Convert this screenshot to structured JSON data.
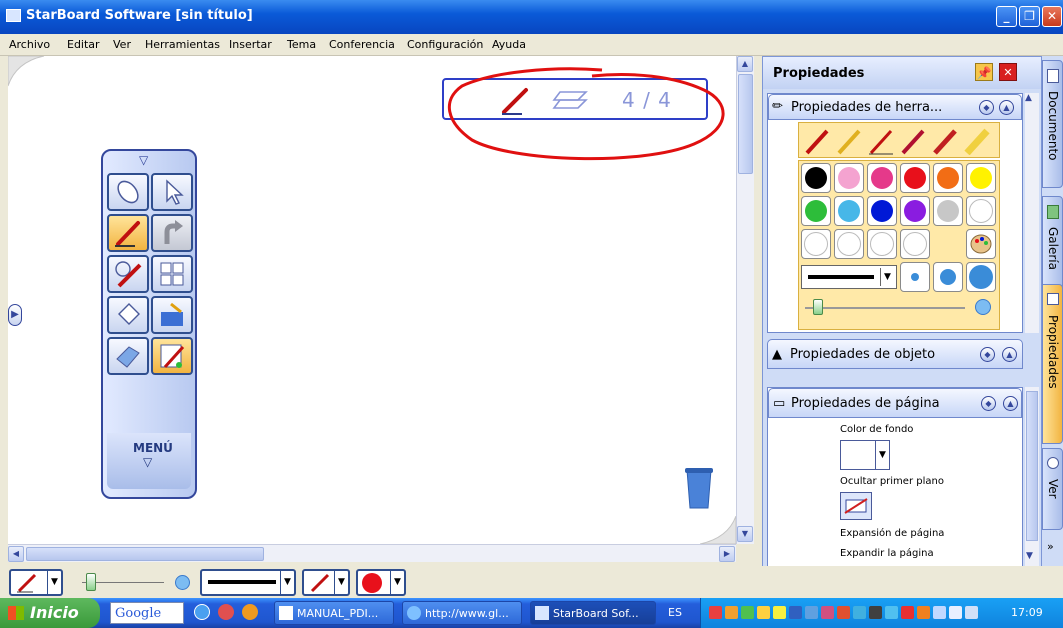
{
  "window": {
    "title": "StarBoard Software [sin título]"
  },
  "menu": [
    "Archivo",
    "Editar",
    "Ver",
    "Herramientas",
    "Insertar",
    "Tema",
    "Conferencia",
    "Configuración",
    "Ayuda"
  ],
  "page_indicator": "4 / 4",
  "toolbar": {
    "menu_label": "MENÚ"
  },
  "panel": {
    "title": "Propiedades",
    "tool_section": "Propiedades de herra...",
    "object_section": "Propiedades de objeto",
    "page_section": "Propiedades de página",
    "bg_color_label": "Color de fondo",
    "hide_fg_label": "Ocultar primer plano",
    "expand_label": "Expansión de página",
    "expand_option": "Expandir la página"
  },
  "palette_colors": [
    "#000000",
    "#f4a3d0",
    "#e5398a",
    "#e8101b",
    "#f26d15",
    "#fff200",
    "#2dbd3a",
    "#47b7e8",
    "#0019d6",
    "#8a1ce0",
    "#c7c7c7",
    "#ffffff",
    "#ffffff",
    "#ffffff",
    "#ffffff",
    "#ffffff"
  ],
  "side_tabs": [
    "Documento",
    "Galería",
    "Propiedades",
    "Ver"
  ],
  "taskbar": {
    "start_label": "Inicio",
    "google": "Google",
    "tasks": [
      "MANUAL_PDI...",
      "http://www.gl...",
      "StarBoard Sof..."
    ],
    "lang": "ES",
    "clock": "17:09"
  },
  "colors": {
    "accent": "#0a5ad8",
    "annotation": "#e01010",
    "selection": "#2e3fc7"
  }
}
